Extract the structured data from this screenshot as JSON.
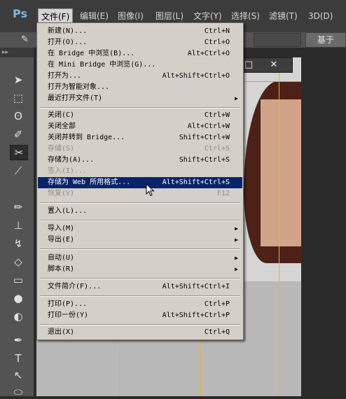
{
  "app": {
    "logo": "Ps"
  },
  "menubar": {
    "items": [
      "文件(F)",
      "编辑(E)",
      "图像(I)",
      "图层(L)",
      "文字(Y)",
      "选择(S)",
      "滤镜(T)",
      "3D(D)"
    ]
  },
  "options_bar": {
    "button_label": "基于"
  },
  "document": {
    "close_glyph": "✕",
    "restore_glyph": "□"
  },
  "file_menu": {
    "items": [
      {
        "label": "新建(N)...",
        "shortcut": "Ctrl+N"
      },
      {
        "label": "打开(O)...",
        "shortcut": "Ctrl+O"
      },
      {
        "label": "在 Bridge 中浏览(B)...",
        "shortcut": "Alt+Ctrl+O"
      },
      {
        "label": "在 Mini Bridge 中浏览(G)...",
        "shortcut": ""
      },
      {
        "label": "打开为...",
        "shortcut": "Alt+Shift+Ctrl+O"
      },
      {
        "label": "打开为智能对象...",
        "shortcut": ""
      },
      {
        "label": "最近打开文件(T)",
        "shortcut": ""
      },
      {
        "label": "关闭(C)",
        "shortcut": "Ctrl+W"
      },
      {
        "label": "关闭全部",
        "shortcut": "Alt+Ctrl+W"
      },
      {
        "label": "关闭并转到 Bridge...",
        "shortcut": "Shift+Ctrl+W"
      },
      {
        "label": "存储(S)",
        "shortcut": "Ctrl+S"
      },
      {
        "label": "存储为(A)...",
        "shortcut": "Shift+Ctrl+S"
      },
      {
        "label": "签入(I)...",
        "shortcut": ""
      },
      {
        "label": "存储为 Web 所用格式...",
        "shortcut": "Alt+Shift+Ctrl+S"
      },
      {
        "label": "恢复(V)",
        "shortcut": "F12"
      },
      {
        "label": "置入(L)...",
        "shortcut": ""
      },
      {
        "label": "导入(M)",
        "shortcut": ""
      },
      {
        "label": "导出(E)",
        "shortcut": ""
      },
      {
        "label": "自动(U)",
        "shortcut": ""
      },
      {
        "label": "脚本(R)",
        "shortcut": ""
      },
      {
        "label": "文件简介(F)...",
        "shortcut": "Alt+Shift+Ctrl+I"
      },
      {
        "label": "打印(P)...",
        "shortcut": "Ctrl+P"
      },
      {
        "label": "打印一份(Y)",
        "shortcut": "Alt+Shift+Ctrl+P"
      },
      {
        "label": "退出(X)",
        "shortcut": "Ctrl+Q"
      }
    ]
  }
}
